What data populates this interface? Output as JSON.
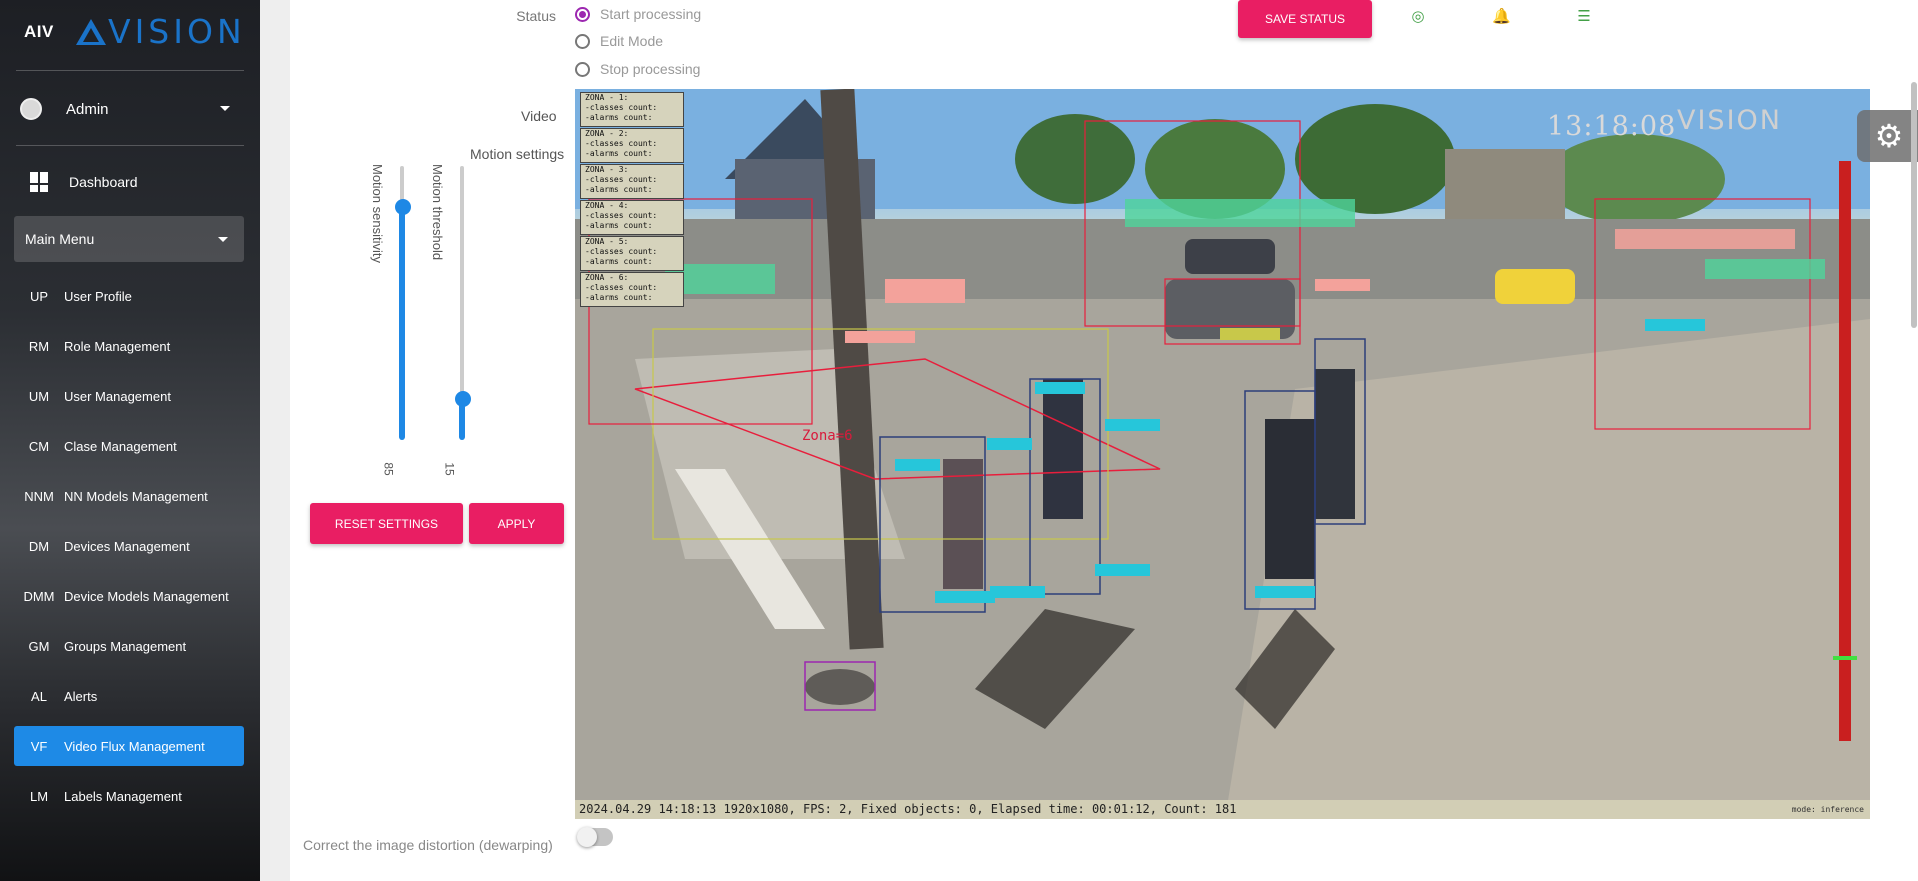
{
  "brand": {
    "mini": "AIV",
    "logo": "VISION"
  },
  "user": {
    "name": "Admin"
  },
  "nav": {
    "dashboard": "Dashboard",
    "main_menu": "Main Menu",
    "items": [
      {
        "abbr": "UP",
        "label": "User Profile"
      },
      {
        "abbr": "RM",
        "label": "Role Management"
      },
      {
        "abbr": "UM",
        "label": "User Management"
      },
      {
        "abbr": "CM",
        "label": "Clase Management"
      },
      {
        "abbr": "NNM",
        "label": "NN Models Management"
      },
      {
        "abbr": "DM",
        "label": "Devices Management"
      },
      {
        "abbr": "DMM",
        "label": "Device Models Management"
      },
      {
        "abbr": "GM",
        "label": "Groups Management"
      },
      {
        "abbr": "AL",
        "label": "Alerts"
      },
      {
        "abbr": "VF",
        "label": "Video Flux Management",
        "active": true
      },
      {
        "abbr": "LM",
        "label": "Labels Management"
      }
    ]
  },
  "status": {
    "label": "Status",
    "options": [
      "Start processing",
      "Edit Mode",
      "Stop processing"
    ],
    "selected": "Start processing",
    "save_label": "SAVE STATUS"
  },
  "icons": [
    "globe-icon",
    "bell-icon",
    "list-icon",
    "gear-icon"
  ],
  "video_label": "Video",
  "motion": {
    "label": "Motion settings",
    "sensitivity_label": "Motion sensitivity",
    "sensitivity_value": "85",
    "sensitivity_level": 0.85,
    "threshold_label": "Motion threshold",
    "threshold_value": "15",
    "threshold_level": 0.15
  },
  "buttons": {
    "reset": "RESET SETTINGS",
    "apply": "APPLY"
  },
  "video": {
    "time": "13:18:08",
    "logo": "VISION",
    "footer": "2024.04.29 14:18:13 1920x1080, FPS: 2, Fixed objects: 0, Elapsed time: 00:01:12, Count: 181",
    "mode": "mode: inference",
    "zona_label": "Zona=6",
    "zones": [
      {
        "name": "ZONA - 1:",
        "classes": "-classes count:",
        "alarms": "-alarms count:"
      },
      {
        "name": "ZONA - 2:",
        "classes": "-classes count:",
        "alarms": "-alarms count:"
      },
      {
        "name": "ZONA - 3:",
        "classes": "-classes count:",
        "alarms": "-alarms count:"
      },
      {
        "name": "ZONA - 4:",
        "classes": "-classes count:",
        "alarms": "-alarms count:"
      },
      {
        "name": "ZONA - 5:",
        "classes": "-classes count:",
        "alarms": "-alarms count:"
      },
      {
        "name": "ZONA - 6:",
        "classes": "-classes count:",
        "alarms": "-alarms count:"
      }
    ]
  },
  "dewarp": {
    "label": "Correct the image distortion (dewarping)",
    "enabled": false
  }
}
